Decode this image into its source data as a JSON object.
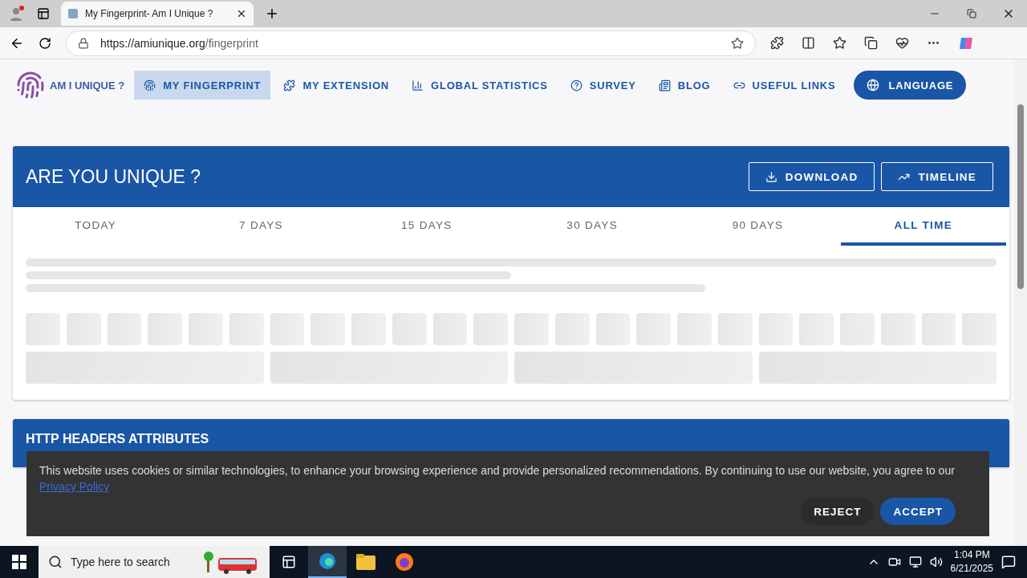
{
  "browser": {
    "tab_title": "My Fingerprint- Am I Unique ?",
    "url_host": "https://amiunique.org",
    "url_path": "/fingerprint"
  },
  "site": {
    "logo_text": "AM I UNIQUE ?",
    "nav": [
      {
        "label": "MY FINGERPRINT",
        "selected": true
      },
      {
        "label": "MY EXTENSION",
        "selected": false
      },
      {
        "label": "GLOBAL STATISTICS",
        "selected": false
      },
      {
        "label": "SURVEY",
        "selected": false
      },
      {
        "label": "BLOG",
        "selected": false
      },
      {
        "label": "USEFUL LINKS",
        "selected": false
      }
    ],
    "language_button": "LANGUAGE"
  },
  "unique_card": {
    "title": "ARE YOU UNIQUE ?",
    "buttons": [
      {
        "label": "DOWNLOAD"
      },
      {
        "label": "TIMELINE"
      }
    ],
    "tabs": [
      {
        "label": "TODAY",
        "selected": false
      },
      {
        "label": "7 DAYS",
        "selected": false
      },
      {
        "label": "15 DAYS",
        "selected": false
      },
      {
        "label": "30 DAYS",
        "selected": false
      },
      {
        "label": "90 DAYS",
        "selected": false
      },
      {
        "label": "ALL TIME",
        "selected": true
      }
    ]
  },
  "headers_card": {
    "title": "HTTP HEADERS ATTRIBUTES"
  },
  "cookie_banner": {
    "text": "This website uses cookies or similar technologies, to enhance your browsing experience and provide personalized recommendations. By continuing to use our website, you agree to our",
    "link": "Privacy Policy",
    "reject": "REJECT",
    "accept": "ACCEPT"
  },
  "taskbar": {
    "search_placeholder": "Type here to search",
    "time": "1:04 PM",
    "date": "6/21/2025"
  }
}
